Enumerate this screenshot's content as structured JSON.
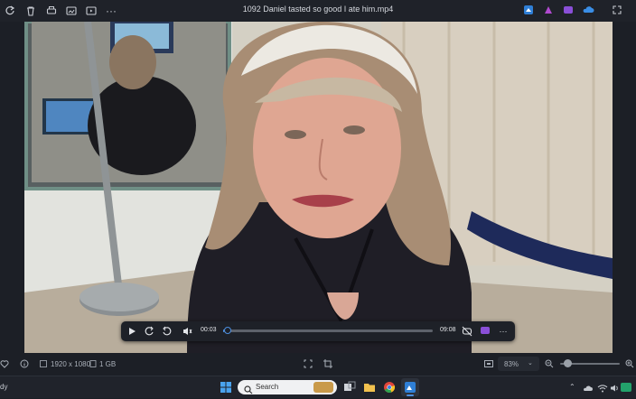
{
  "window": {
    "title": "1092 Daniel tasted so good I ate him.mp4"
  },
  "player": {
    "current_time": "00:03",
    "duration": "09:08",
    "progress": 0.006
  },
  "infobar": {
    "resolution": "1920 x 1080",
    "size": "1 GB",
    "zoom": "83%",
    "zoom_level": 0.12
  },
  "taskbar": {
    "search_placeholder": "Search",
    "left_status": "dy"
  },
  "colors": {
    "accent": "#4c8fe0",
    "app_bg": "#1c1f26"
  }
}
